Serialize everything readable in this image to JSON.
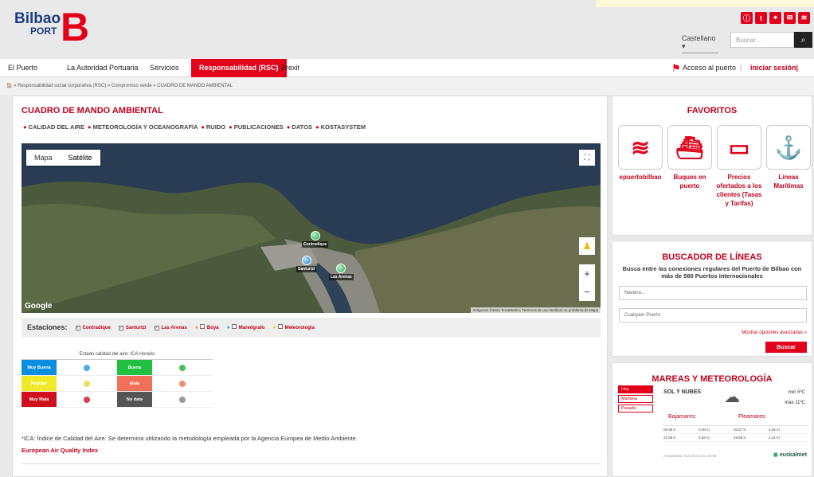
{
  "header": {
    "logo_word": "Bilbao",
    "logo_port": "PORT",
    "logo_letter": "B",
    "language": "Castellano ▾",
    "search_placeholder": "Buscar...",
    "social": [
      "ⓘ",
      "t",
      "⌖",
      "✉",
      "≋"
    ]
  },
  "nav": {
    "items": [
      "El Puerto",
      "La Autoridad Portuaria",
      "Servicios",
      "Responsabilidad (RSC)",
      "Brexit"
    ],
    "access": "Acceso al puerto",
    "login": "iniciar sesión| registro",
    "sep": "|"
  },
  "breadcrumb": "🏠 » Responsabilidad social corporativa (RSC) » Compromiso verde » CUADRO DE MANDO AMBIENTAL",
  "main": {
    "title": "CUADRO DE MANDO AMBIENTAL",
    "tabs": [
      "CALIDAD DEL AIRE",
      "METEOROLOGÍA Y OCEANOGRAFÍA",
      "RUIDO",
      "PUBLICACIONES",
      "DATOS",
      "KOSTASYSTEM"
    ]
  },
  "map": {
    "tab_map": "Mapa",
    "tab_sat": "Satélite",
    "google": "Google",
    "footer": "Imágenes ©2022 TerraMetrics  Términos de uso  Notificar un problema de Maps",
    "fullscreen": "⛶",
    "pegman": "♟",
    "zoom_in": "+",
    "zoom_out": "−",
    "pins": [
      "Contradique",
      "Santurtzi",
      "Las Arenas"
    ]
  },
  "stations": {
    "heading": "Estaciones:",
    "items": [
      "Contradique",
      "Santurtzi",
      "Las Arenas",
      "Boya",
      "Mareógrafo",
      "Meteorología"
    ]
  },
  "ica": {
    "title": "Estado calidad del aire: ICA Horario",
    "rows": [
      [
        "Muy Buena",
        "Buena"
      ],
      [
        "Regular",
        "Mala"
      ],
      [
        "Muy Mala",
        "No data"
      ]
    ]
  },
  "footnote": "*ICA: Índice de Calidad del Aire. Se determina utilizando la metodología empleada por la Agencia Europea de Medio Ambiente.",
  "footlink": "European Air Quality Index",
  "favoritos": {
    "title": "FAVORITOS",
    "items": [
      "epuertobilbao",
      "Buques en puerto",
      "Precios ofertados a los clientes (Tasas y Tarifas)",
      "Líneas Marítimas"
    ]
  },
  "buscador": {
    "title": "BUSCADOR DE LÍNEAS",
    "desc": "Busca entre las conexiones regulares del Puerto de Bilbao con más de 580 Puertos Internacionales",
    "naviera": "Naviera...",
    "puerto": "Cualquier Puerto",
    "advanced": "Mostrar opciones avanzadas »",
    "button": "Buscar"
  },
  "mareas": {
    "title": "MAREAS Y METEOROLOGÍA",
    "tabs": [
      "Hoy",
      "Mañana",
      "Pasado"
    ],
    "weather": "SOL Y NUBES",
    "min": "min 5ºC",
    "max": "max 11ºC",
    "baja_label": "Bajamares:",
    "plea_label": "Pleamares:",
    "baja": [
      [
        "09:35 h.",
        "0,46 m."
      ],
      [
        "21:55 h.",
        "0,82 m."
      ]
    ],
    "plea": [
      [
        "03:27 h.",
        "4,45 m."
      ],
      [
        "15:56 h.",
        "4,31 m."
      ]
    ],
    "updated": "Actualizado: 31/12/22 a las 20:50",
    "brand": "euskalmet"
  }
}
